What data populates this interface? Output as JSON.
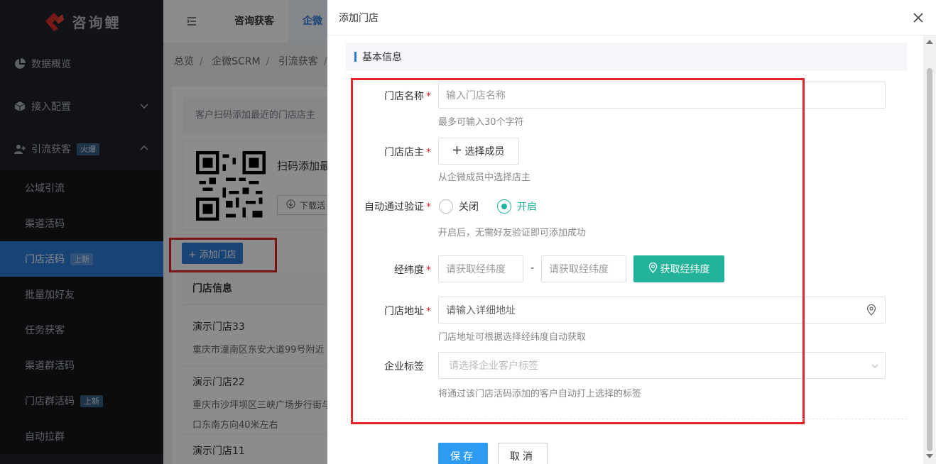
{
  "app": {
    "logo_text": "咨询鲤"
  },
  "sidebar": {
    "items": [
      {
        "label": "数据概览",
        "icon": "pie-chart-icon"
      },
      {
        "label": "接入配置",
        "icon": "cube-icon"
      },
      {
        "label": "引流获客",
        "icon": "user-add-icon",
        "badge": "火爆"
      }
    ],
    "sub_items": [
      {
        "label": "公域引流"
      },
      {
        "label": "渠道活码"
      },
      {
        "label": "门店活码",
        "badge": "上新"
      },
      {
        "label": "批量加好友"
      },
      {
        "label": "任务获客"
      },
      {
        "label": "渠道群活码"
      },
      {
        "label": "门店群活码",
        "badge": "上新"
      },
      {
        "label": "自动拉群"
      }
    ]
  },
  "header": {
    "tabs": [
      {
        "label": "咨询获客"
      },
      {
        "label": "企微"
      }
    ]
  },
  "breadcrumb": [
    "总览",
    "企微SCRM",
    "引流获客"
  ],
  "page": {
    "tip": "客户扫码添加最近的门店店主",
    "qr_title": "扫码添加最",
    "download_label": "下载活",
    "add_store_label": "+ 添加门店",
    "store_header": "门店信息",
    "stores": [
      {
        "name": "演示门店33",
        "address_lines": [
          "重庆市潼南区东安大道99号附近"
        ]
      },
      {
        "name": "演示门店22",
        "address_lines": [
          "重庆市沙坪坝区三峡广场步行街与",
          "口东南方向40米左右"
        ]
      },
      {
        "name": "演示门店11",
        "address_lines": []
      }
    ]
  },
  "drawer": {
    "title": "添加门店",
    "section_title": "基本信息",
    "store_name": {
      "label": "门店名称",
      "placeholder": "输入门店名称",
      "hint": "最多可输入30个字符"
    },
    "owner": {
      "label": "门店店主",
      "button": "选择成员",
      "hint": "从企微成员中选择店主"
    },
    "auto_verify": {
      "label": "自动通过验证",
      "options": [
        "关闭",
        "开启"
      ],
      "selected": "开启",
      "hint": "开启后，无需好友验证即可添加成功"
    },
    "lnglat": {
      "label": "经纬度",
      "placeholder_a": "请获取经纬度",
      "placeholder_b": "请获取经纬度",
      "separator": "-",
      "button": "获取经纬度"
    },
    "address": {
      "label": "门店地址",
      "placeholder": "请输入详细地址",
      "hint": "门店地址可根据选择经纬度自动获取"
    },
    "tags": {
      "label": "企业标签",
      "placeholder": "请选择企业客户标签",
      "hint": "将通过该门店活码添加的客户自动打上选择的标签"
    },
    "required_mark": "*",
    "save_label": "保存",
    "cancel_label": "取消"
  },
  "colors": {
    "primary": "#2d7ad6",
    "accent_green": "#23b39b",
    "highlight_red": "#e0262b"
  }
}
